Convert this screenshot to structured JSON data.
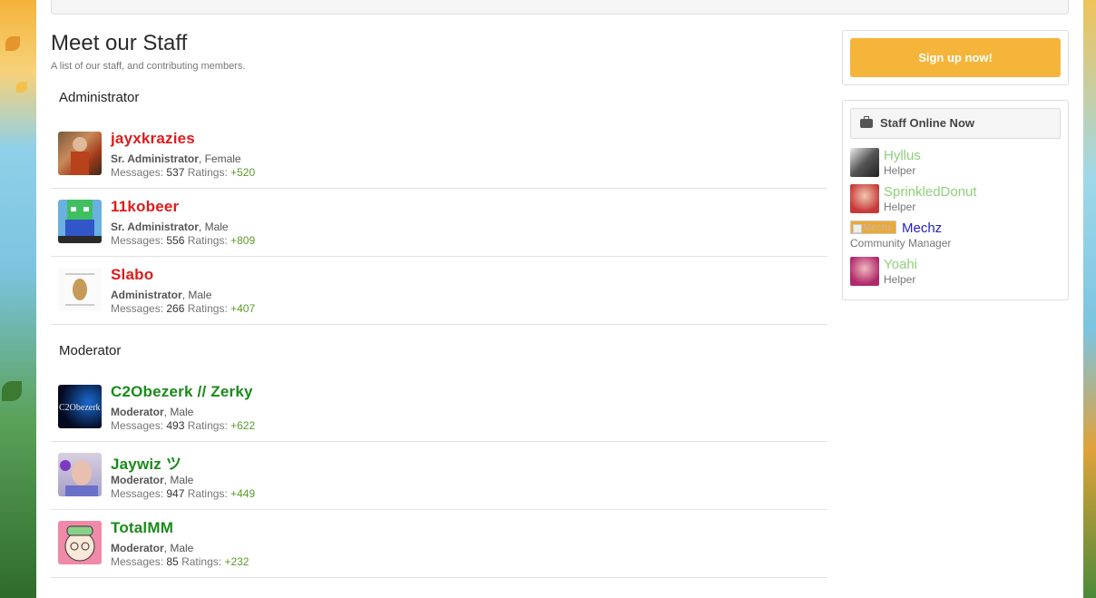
{
  "page": {
    "title": "Meet our Staff",
    "description": "A list of our staff, and contributing members."
  },
  "groups": [
    {
      "title": "Administrator",
      "members": [
        {
          "name": "jayxkrazies",
          "rank": "Sr. Administrator",
          "gender": ", Female",
          "messages_label": "Messages:",
          "messages": "537",
          "ratings_label": "Ratings:",
          "ratings": "+520",
          "avatar_icon": "avatar-jayxkrazies"
        },
        {
          "name": "11kobeer",
          "rank": "Sr. Administrator",
          "gender": ", Male",
          "messages_label": "Messages:",
          "messages": "556",
          "ratings_label": "Ratings:",
          "ratings": "+809",
          "avatar_icon": "avatar-11kobeer"
        },
        {
          "name": "Slabo",
          "rank": "Administrator",
          "gender": ", Male",
          "messages_label": "Messages:",
          "messages": "266",
          "ratings_label": "Ratings:",
          "ratings": "+407",
          "avatar_icon": "avatar-slabo"
        }
      ]
    },
    {
      "title": "Moderator",
      "members": [
        {
          "name": "C2Obezerk // Zerky",
          "rank": "Moderator",
          "gender": ", Male",
          "messages_label": "Messages:",
          "messages": "493",
          "ratings_label": "Ratings:",
          "ratings": "+622",
          "avatar_icon": "avatar-c2obezerk",
          "avatar_text": "C2Obezerk"
        },
        {
          "name": "Jaywiz ツ",
          "rank": "Moderator",
          "gender": ", Male",
          "messages_label": "Messages:",
          "messages": "947",
          "ratings_label": "Ratings:",
          "ratings": "+449",
          "avatar_icon": "avatar-jaywiz"
        },
        {
          "name": "TotalMM",
          "rank": "Moderator",
          "gender": ", Male",
          "messages_label": "Messages:",
          "messages": "85",
          "ratings_label": "Ratings:",
          "ratings": "+232",
          "avatar_icon": "avatar-totalmm"
        }
      ]
    }
  ],
  "sidebar": {
    "signup_label": "Sign up now!",
    "online_title": "Staff Online Now",
    "online_icon": "briefcase-icon",
    "online": [
      {
        "name": "Hyllus",
        "title": "Helper"
      },
      {
        "name": "SprinkledDonut",
        "title": "Helper"
      },
      {
        "name": "Mechz",
        "title": "Community Manager",
        "broken_alt": "Mechz"
      },
      {
        "name": "Yoahi",
        "title": "Helper"
      }
    ]
  },
  "colors": {
    "admin_name": "#e01b1b",
    "mod_name": "#1a8a1a",
    "helper_name": "#8fd07a",
    "manager_name": "#2222cc",
    "signup_button": "#f5b53a",
    "positive_rating": "#5a9a2a"
  }
}
